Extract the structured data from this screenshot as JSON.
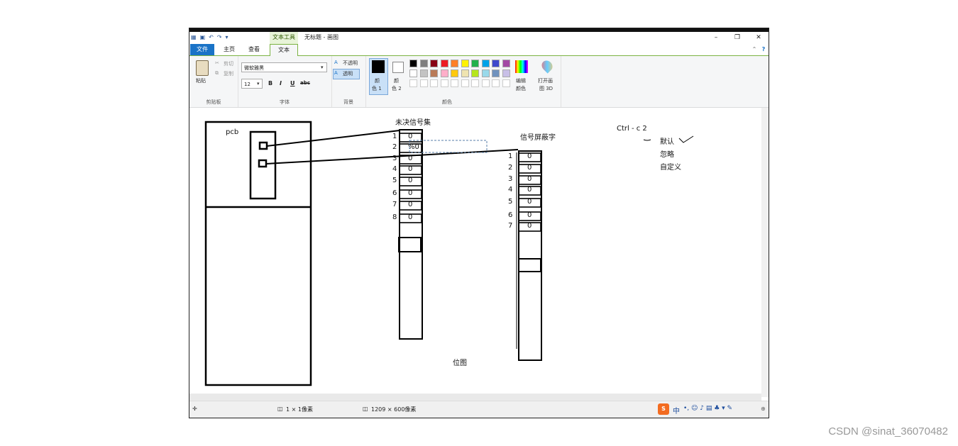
{
  "titlebar": {
    "context_tab": "文本工具",
    "title": "无标题 - 画图",
    "minimize": "–",
    "restore": "❐",
    "close": "✕"
  },
  "tabs": {
    "file": "文件",
    "home": "主页",
    "view": "查看",
    "text": "文本"
  },
  "ribbon": {
    "clipboard": {
      "paste": "粘贴",
      "cut": "剪切",
      "copy": "复制",
      "group": "剪贴板"
    },
    "font": {
      "family": "微软雅黑",
      "size": "12",
      "bold": "B",
      "italic": "I",
      "underline": "U",
      "strike": "abc",
      "group": "字体"
    },
    "background": {
      "opaque": "不透明",
      "transparent": "透明",
      "group": "背景"
    },
    "colors": {
      "color1_a": "颜",
      "color1_b": "色 1",
      "color2_a": "颜",
      "color2_b": "色 2",
      "edit_a": "编辑",
      "edit_b": "颜色",
      "paint3d_a": "打开画",
      "paint3d_b": "图 3D",
      "group": "颜色",
      "palette_row1": [
        "#000000",
        "#7f7f7f",
        "#880015",
        "#ed1c24",
        "#ff7f27",
        "#fff200",
        "#22b14c",
        "#00a2e8",
        "#3f48cc",
        "#a349a4"
      ],
      "palette_row2": [
        "#ffffff",
        "#c3c3c3",
        "#b97a57",
        "#ffaec9",
        "#ffc90e",
        "#efe4b0",
        "#b5e61d",
        "#99d9ea",
        "#7092be",
        "#c8bfe7"
      ]
    }
  },
  "canvas": {
    "pcb": "pcb",
    "pending_title": "未决信号集",
    "mask_title": "信号屏蔽字",
    "bitmap": "位图",
    "ctrl": "Ctrl - c  2",
    "default": "默认",
    "ignore": "忽略",
    "custom": "自定义",
    "pending_rows": [
      {
        "n": "1",
        "v": "0"
      },
      {
        "n": "2",
        "v": "%0"
      },
      {
        "n": "3",
        "v": "0"
      },
      {
        "n": "4",
        "v": "0"
      },
      {
        "n": "5",
        "v": "0"
      },
      {
        "n": "6",
        "v": "0"
      },
      {
        "n": "7",
        "v": "0"
      },
      {
        "n": "8",
        "v": "0"
      }
    ],
    "mask_rows": [
      {
        "n": "1",
        "v": "0"
      },
      {
        "n": "2",
        "v": "0"
      },
      {
        "n": "3",
        "v": "0"
      },
      {
        "n": "4",
        "v": "0"
      },
      {
        "n": "5",
        "v": "0"
      },
      {
        "n": "6",
        "v": "0"
      },
      {
        "n": "7",
        "v": "0"
      }
    ]
  },
  "status": {
    "size1": "1 × 1像素",
    "size2": "1209 × 600像素",
    "ime": "中"
  },
  "watermark": "CSDN @sinat_36070482"
}
